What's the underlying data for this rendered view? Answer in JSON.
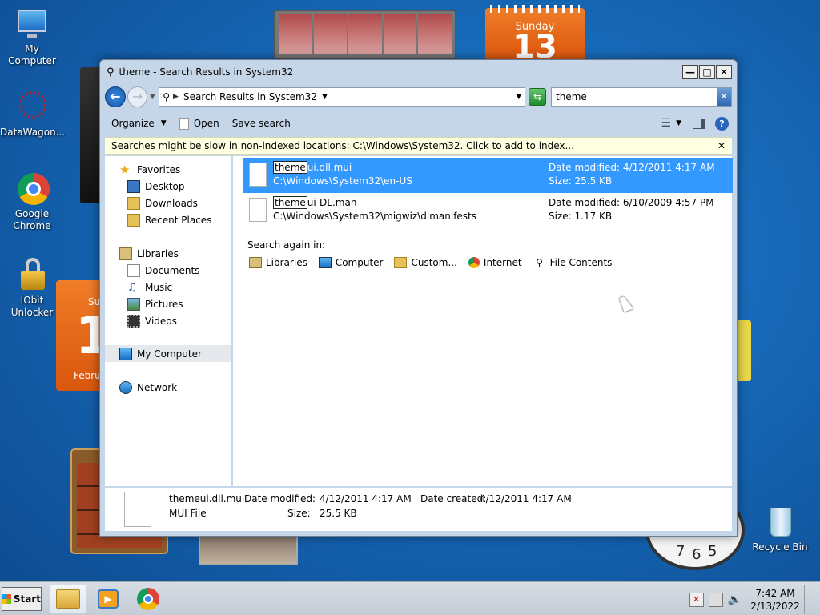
{
  "desktop": {
    "icons": [
      {
        "label": "My Computer"
      },
      {
        "label": "DataWagon..."
      },
      {
        "label": "Google Chrome"
      },
      {
        "label": "IObit Unlocker"
      },
      {
        "label": "Recycle Bin"
      }
    ],
    "gadgets": {
      "calendar_top_day": "Sunday",
      "calendar_top_date": "13",
      "calendar_left_date": "1",
      "calendar_left_month": "Febru",
      "calendar_left_day": "Su",
      "clock_numbers": [
        "7",
        "6",
        "5"
      ]
    }
  },
  "window": {
    "title": "theme - Search Results in System32",
    "address": "Search Results in System32",
    "search_value": "theme",
    "toolbar": {
      "organize": "Organize",
      "open": "Open",
      "save_search": "Save search"
    },
    "infobar": "Searches might be slow in non-indexed locations: C:\\Windows\\System32. Click to add to index...",
    "nav": {
      "favorites": "Favorites",
      "desktop": "Desktop",
      "downloads": "Downloads",
      "recent_places": "Recent Places",
      "libraries": "Libraries",
      "documents": "Documents",
      "music": "Music",
      "pictures": "Pictures",
      "videos": "Videos",
      "my_computer": "My Computer",
      "network": "Network"
    },
    "results": [
      {
        "match": "theme",
        "rest": "ui.dll.mui",
        "path": "C:\\Windows\\System32\\en-US",
        "date_modified": "Date modified: 4/12/2011 4:17 AM",
        "size": "Size: 25.5 KB",
        "selected": true
      },
      {
        "match": "theme",
        "rest": "ui-DL.man",
        "path": "C:\\Windows\\System32\\migwiz\\dlmanifests",
        "date_modified": "Date modified: 6/10/2009 4:57 PM",
        "size": "Size: 1.17 KB",
        "selected": false
      }
    ],
    "search_again_label": "Search again in:",
    "search_again": [
      "Libraries",
      "Computer",
      "Custom...",
      "Internet",
      "File Contents"
    ],
    "details": {
      "name": "themeui.dll.mui",
      "type": "MUI File",
      "date_modified_label": "Date modified:",
      "date_modified": "4/12/2011 4:17 AM",
      "size_label": "Size:",
      "size": "25.5 KB",
      "date_created_label": "Date created:",
      "date_created": "4/12/2011 4:17 AM"
    }
  },
  "taskbar": {
    "start": "Start",
    "time": "7:42 AM",
    "date": "2/13/2022"
  },
  "colors": {
    "selection": "#3399ff",
    "infobar": "#ffffe1",
    "calendar": "#e8661a"
  }
}
